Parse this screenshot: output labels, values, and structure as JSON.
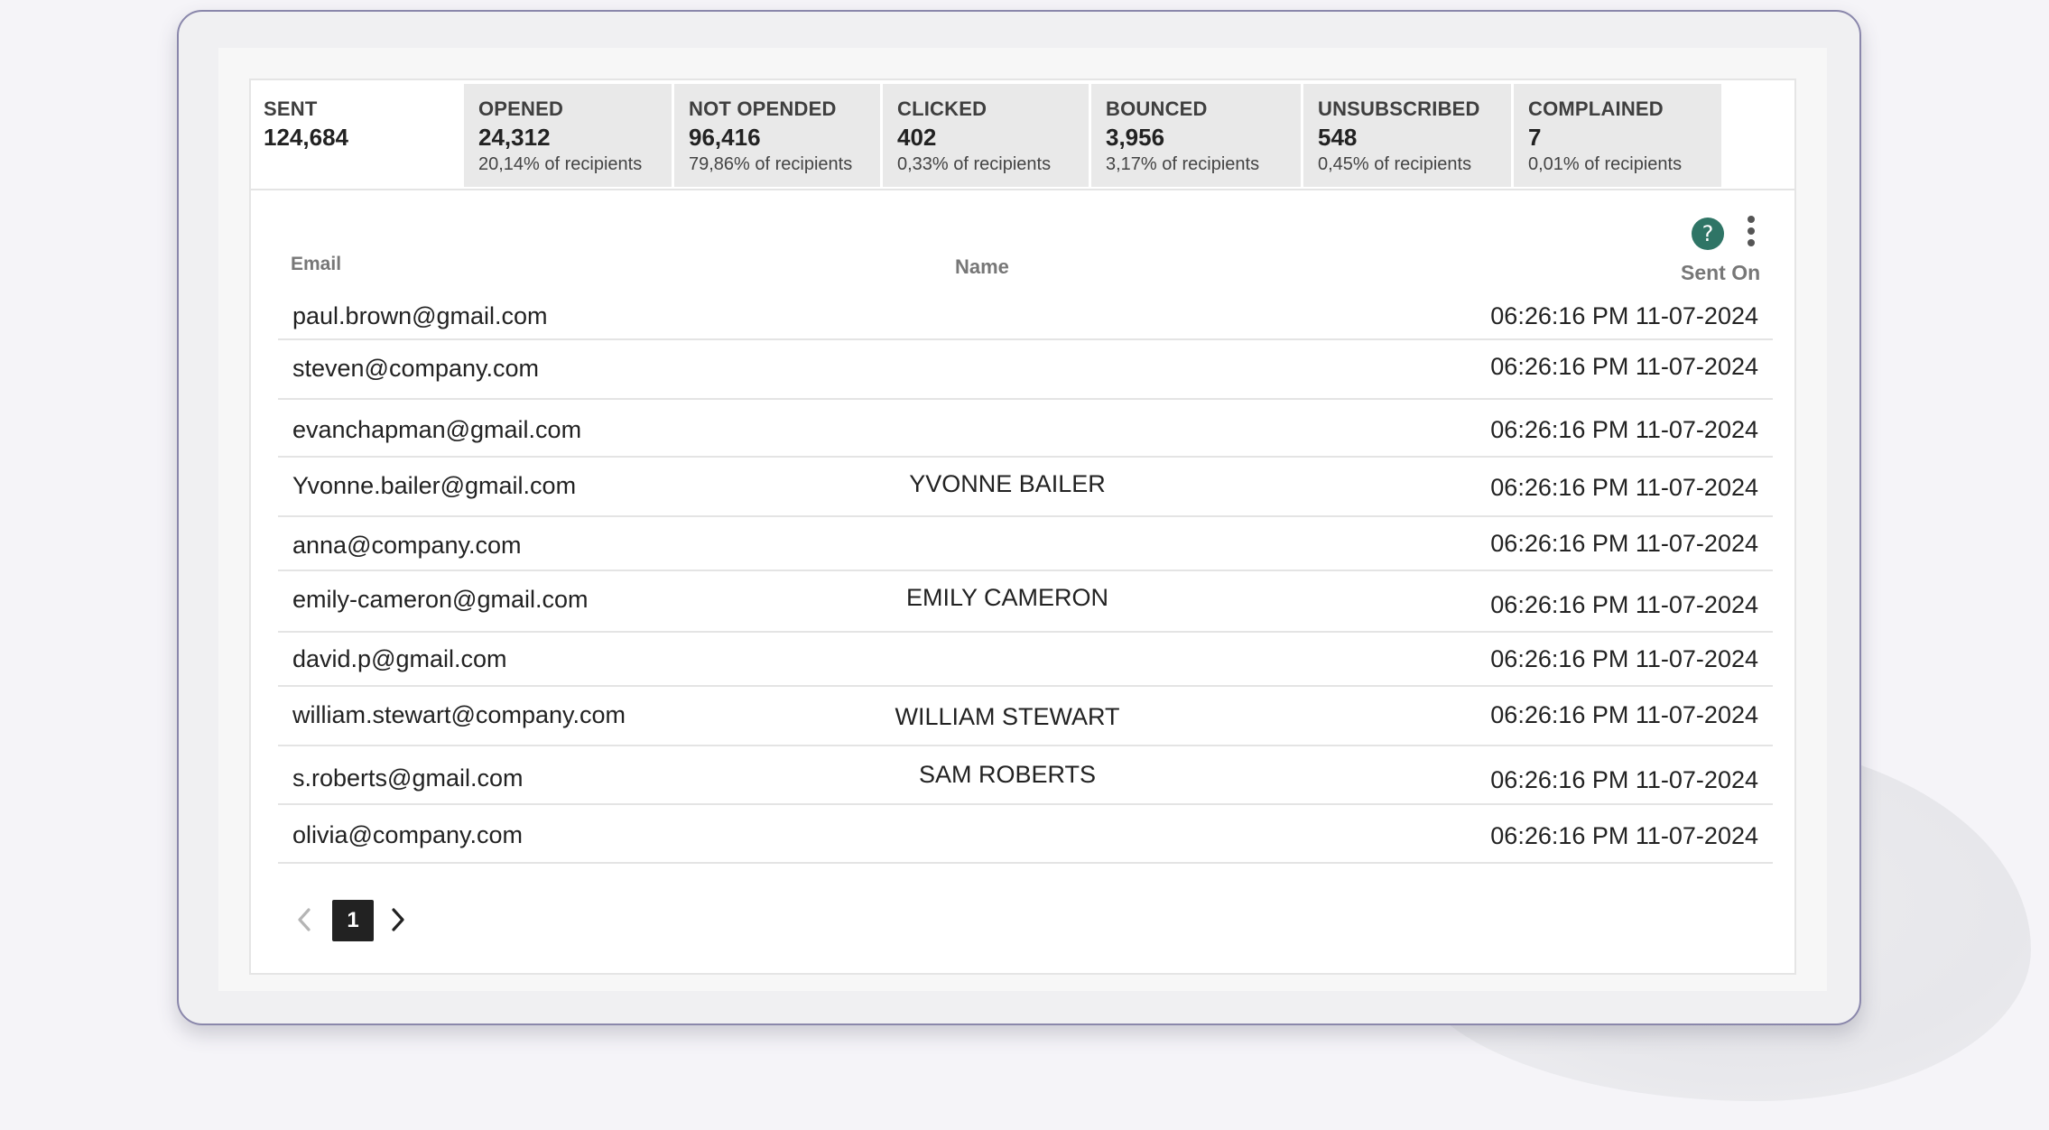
{
  "stats": [
    {
      "label": "SENT",
      "value": "124,684",
      "sub": ""
    },
    {
      "label": "OPENED",
      "value": "24,312",
      "sub": "20,14% of recipients"
    },
    {
      "label": "NOT OPENDED",
      "value": "96,416",
      "sub": "79,86% of recipients"
    },
    {
      "label": "CLICKED",
      "value": "402",
      "sub": "0,33% of recipients"
    },
    {
      "label": "BOUNCED",
      "value": "3,956",
      "sub": "3,17% of recipients"
    },
    {
      "label": "UNSUBSCRIBED",
      "value": "548",
      "sub": "0,45% of recipients"
    },
    {
      "label": "COMPLAINED",
      "value": "7",
      "sub": "0,01% of recipients"
    }
  ],
  "toolbar": {
    "help_glyph": "?"
  },
  "columns": {
    "email": "Email",
    "name": "Name",
    "sent_on": "Sent On"
  },
  "rows": [
    {
      "email": "paul.brown@gmail.com",
      "name": "",
      "sent_on": "06:26:16 PM 11-07-2024"
    },
    {
      "email": "steven@company.com",
      "name": "",
      "sent_on": "06:26:16 PM 11-07-2024"
    },
    {
      "email": "evanchapman@gmail.com",
      "name": "",
      "sent_on": "06:26:16 PM 11-07-2024"
    },
    {
      "email": "Yvonne.bailer@gmail.com",
      "name": "YVONNE BAILER",
      "sent_on": "06:26:16 PM 11-07-2024"
    },
    {
      "email": "anna@company.com",
      "name": "",
      "sent_on": "06:26:16 PM 11-07-2024"
    },
    {
      "email": "emily-cameron@gmail.com",
      "name": "EMILY CAMERON",
      "sent_on": "06:26:16 PM 11-07-2024"
    },
    {
      "email": "david.p@gmail.com",
      "name": "",
      "sent_on": "06:26:16 PM 11-07-2024"
    },
    {
      "email": "william.stewart@company.com",
      "name": "WILLIAM STEWART",
      "sent_on": "06:26:16 PM 11-07-2024"
    },
    {
      "email": "s.roberts@gmail.com",
      "name": "SAM ROBERTS",
      "sent_on": "06:26:16 PM 11-07-2024"
    },
    {
      "email": "olivia@company.com",
      "name": "",
      "sent_on": "06:26:16 PM 11-07-2024"
    }
  ],
  "pagination": {
    "current_page": "1"
  }
}
